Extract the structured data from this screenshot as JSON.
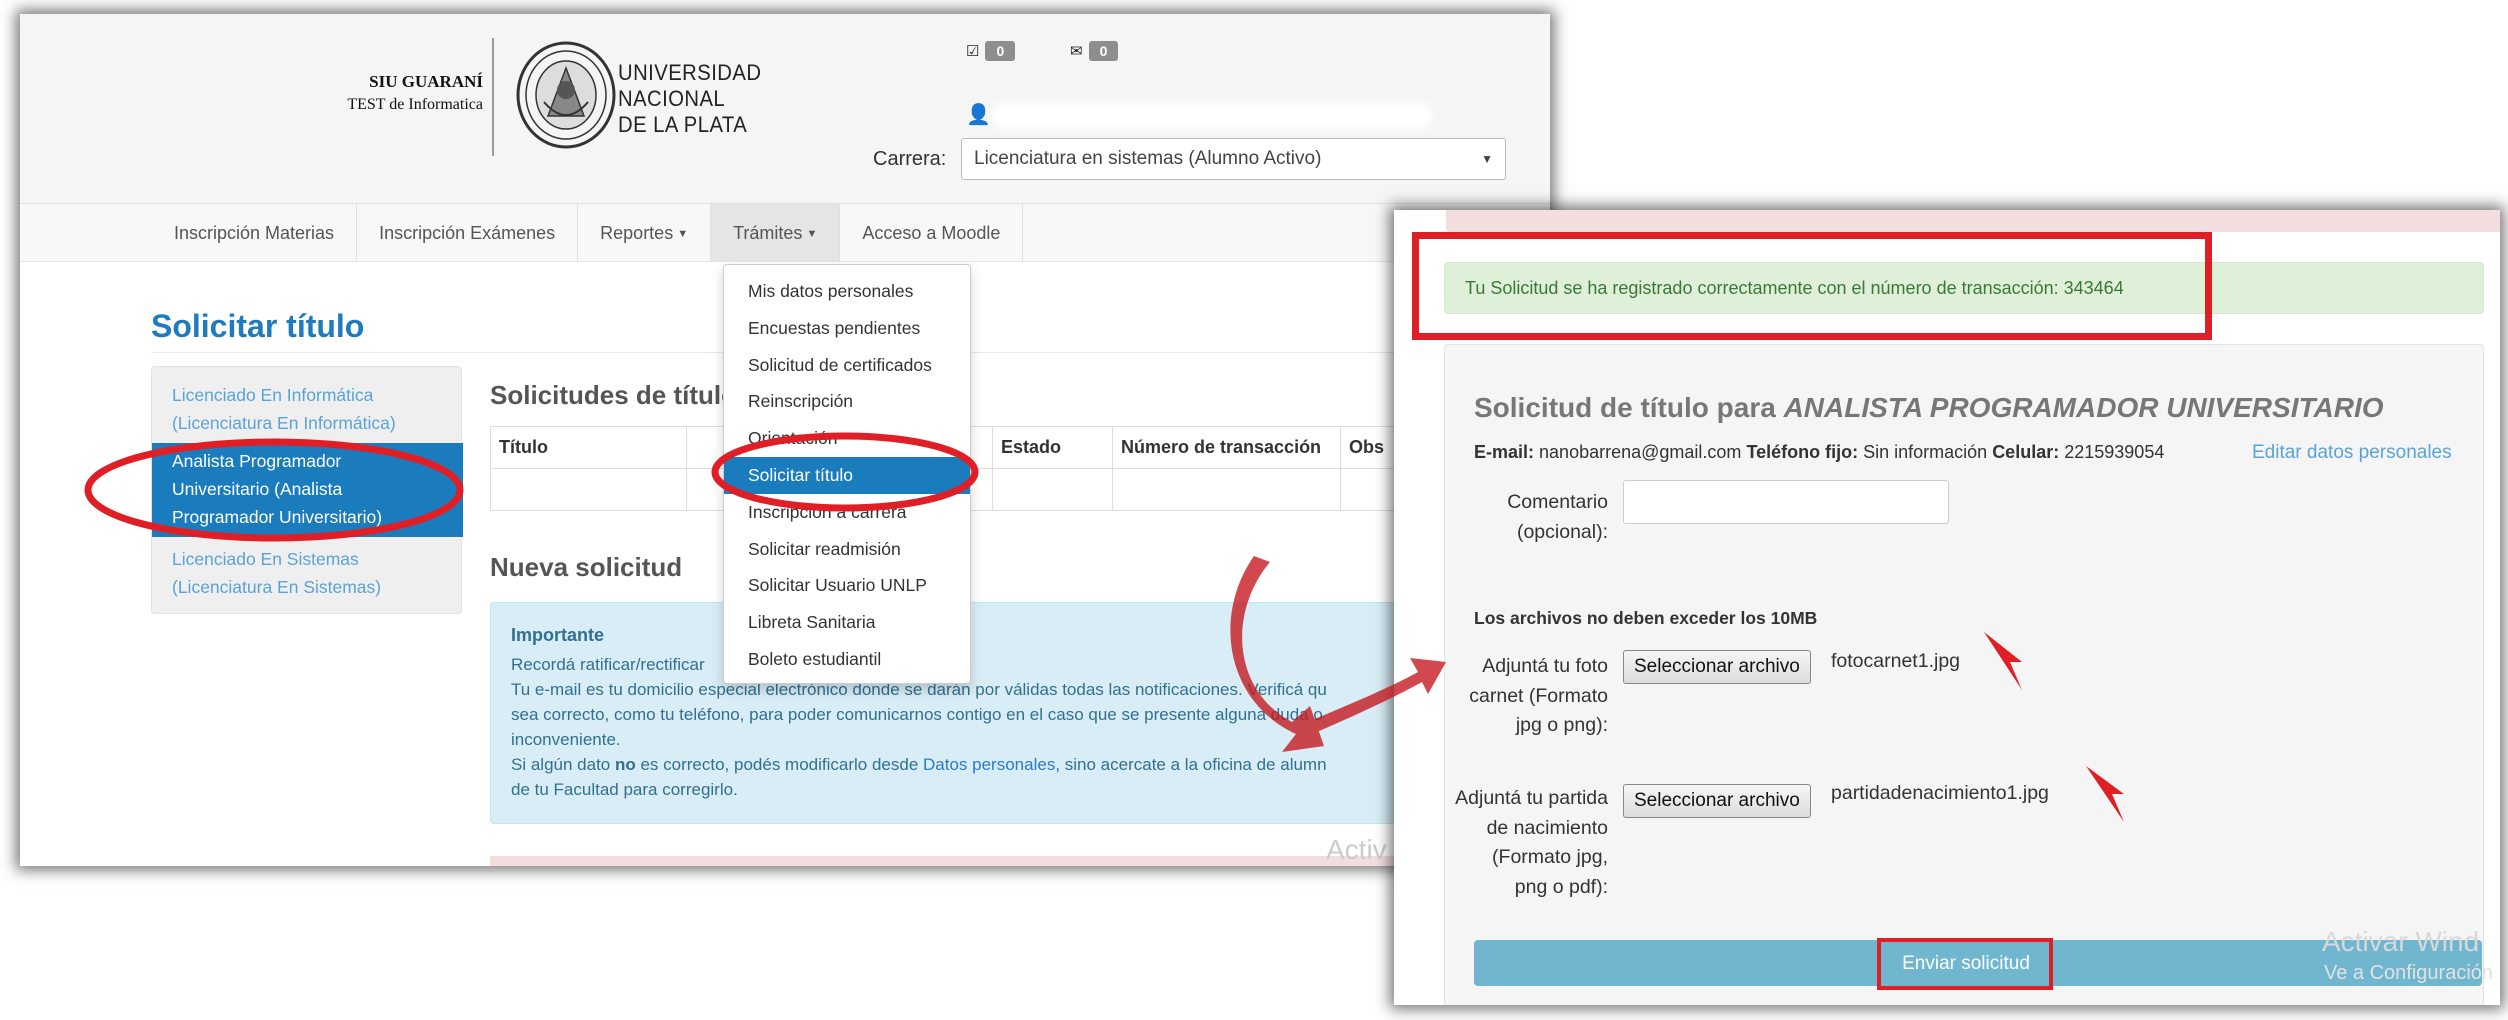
{
  "header": {
    "siu_title": "SIU GUARANÍ",
    "siu_subtitle": "TEST de Informatica",
    "university_lines": [
      "UNIVERSIDAD",
      "NACIONAL",
      "DE LA PLATA"
    ],
    "tasks_count": "0",
    "messages_count": "0",
    "carrera_label": "Carrera:",
    "carrera_value": "Licenciatura en sistemas (Alumno Activo)"
  },
  "nav": {
    "items": [
      {
        "label": "Inscripción Materias"
      },
      {
        "label": "Inscripción Exámenes"
      },
      {
        "label": "Reportes"
      },
      {
        "label": "Trámites"
      },
      {
        "label": "Acceso a Moodle"
      }
    ]
  },
  "dropdown": {
    "items": [
      "Mis datos personales",
      "Encuestas pendientes",
      "Solicitud de certificados",
      "Reinscripción",
      "Orientación",
      "Solicitar título",
      "Inscripción a carrera",
      "Solicitar readmisión",
      "Solicitar Usuario UNLP",
      "Libreta Sanitaria",
      "Boleto estudiantil"
    ],
    "active": "Solicitar título"
  },
  "page": {
    "title": "Solicitar título",
    "side_items": [
      {
        "text": "Licenciado En Informática (Licenciatura En Informática)",
        "lines": [
          "Licenciado En Informática",
          "(Licenciatura En Informática)"
        ]
      },
      {
        "text": "Analista Programador Universitario (Analista Programador Universitario)",
        "lines": [
          "Analista Programador",
          "Universitario (Analista",
          "Programador Universitario)"
        ]
      },
      {
        "text": "Licenciado En Sistemas (Licenciatura En Sistemas)",
        "lines": [
          "Licenciado En Sistemas",
          "(Licenciatura En Sistemas)"
        ]
      }
    ],
    "requests_heading": "Solicitudes de título",
    "table_headers": [
      "Título",
      "",
      "Estado",
      "Número de transacción",
      "Obs"
    ],
    "new_request_heading": "Nueva solicitud",
    "info": {
      "title": "Importante",
      "line1": "Recordá ratificar/rectificar",
      "line2a": "Tu e-mail es tu domicilio especial electrónico donde se darán por válidas todas las notificaciones. Verificá qu",
      "line3": "sea correcto, como tu teléfono, para poder comunicarnos contigo en el caso que se presente alguna duda o",
      "line4": "inconveniente.",
      "line5_pre": "Si algún dato ",
      "line5_bold": "no",
      "line5_mid": " es correcto, podés modificarlo desde ",
      "line5_link": "Datos personales",
      "line5_post": ", sino acercate a la oficina de alumn",
      "line6": "de tu Facultad para corregirlo."
    },
    "watermark": "Activ"
  },
  "form": {
    "success_message": "Tu Solicitud se ha registrado correctamente con el número de transacción: 343464",
    "title_prefix": "Solicitud de título para ",
    "title_degree": "ANALISTA PROGRAMADOR UNIVERSITARIO",
    "email_label": "E-mail:",
    "email": "nanobarrena@gmail.com",
    "phone_label": "Teléfono fijo:",
    "phone": "Sin información",
    "cell_label": "Celular:",
    "cell": "2215939054",
    "edit_link": "Editar datos personales",
    "comment_label_lines": [
      "Comentario",
      "(opcional):"
    ],
    "size_warning": "Los archivos no deben exceder los 10MB",
    "photo_label_lines": [
      "Adjuntá tu foto",
      "carnet (Formato",
      "jpg o png):"
    ],
    "photo_button": "Seleccionar archivo",
    "photo_file": "fotocarnet1.jpg",
    "birth_label_lines": [
      "Adjuntá tu partida",
      "de nacimiento",
      "(Formato jpg,",
      "png o pdf):"
    ],
    "birth_button": "Seleccionar archivo",
    "birth_file": "partidadenacimiento1.jpg",
    "submit": "Enviar solicitud",
    "watermark_line1": "Activar Wind",
    "watermark_line2": "Ve a Configuración"
  },
  "colors": {
    "accent_blue": "#1a7cbd",
    "link_blue": "#5aa3d8",
    "success_bg": "#dff0d8",
    "info_bg": "#d9edf7",
    "annotation_red": "#e01e26"
  },
  "icons": [
    "tasks-icon",
    "envelope-icon",
    "user-icon",
    "university-seal-icon",
    "caret-down-icon",
    "red-curved-arrow",
    "red-arrowhead"
  ]
}
